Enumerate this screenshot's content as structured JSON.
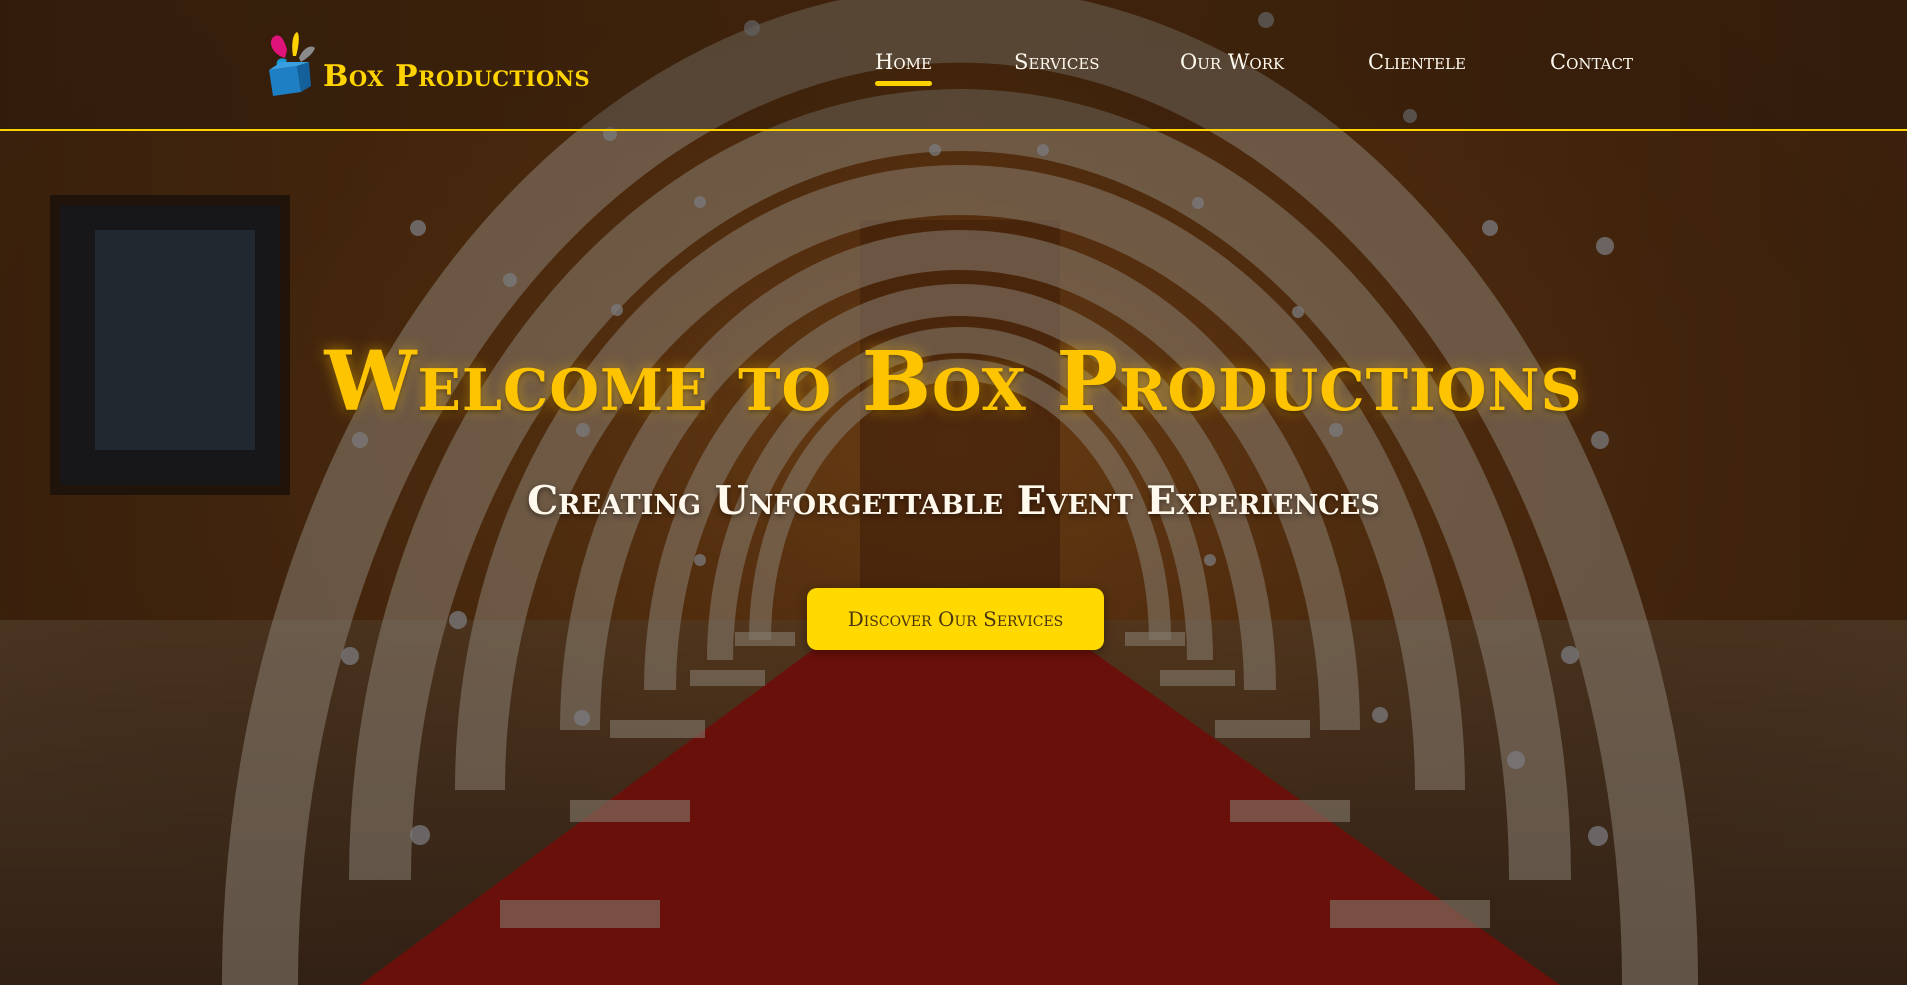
{
  "brand": {
    "name": "Box Productions",
    "accent_color": "#ffd200",
    "logo_icon": "gift-box-splash-icon"
  },
  "nav": {
    "items": [
      {
        "label": "Home",
        "active": true
      },
      {
        "label": "Services",
        "active": false
      },
      {
        "label": "Our Work",
        "active": false
      },
      {
        "label": "Clientele",
        "active": false
      },
      {
        "label": "Contact",
        "active": false
      }
    ]
  },
  "hero": {
    "title": "Welcome to Box Productions",
    "subtitle": "Creating Unforgettable Event Experiences",
    "cta_label": "Discover Our Services",
    "background": "arch-tunnel-red-carpet-photo"
  }
}
